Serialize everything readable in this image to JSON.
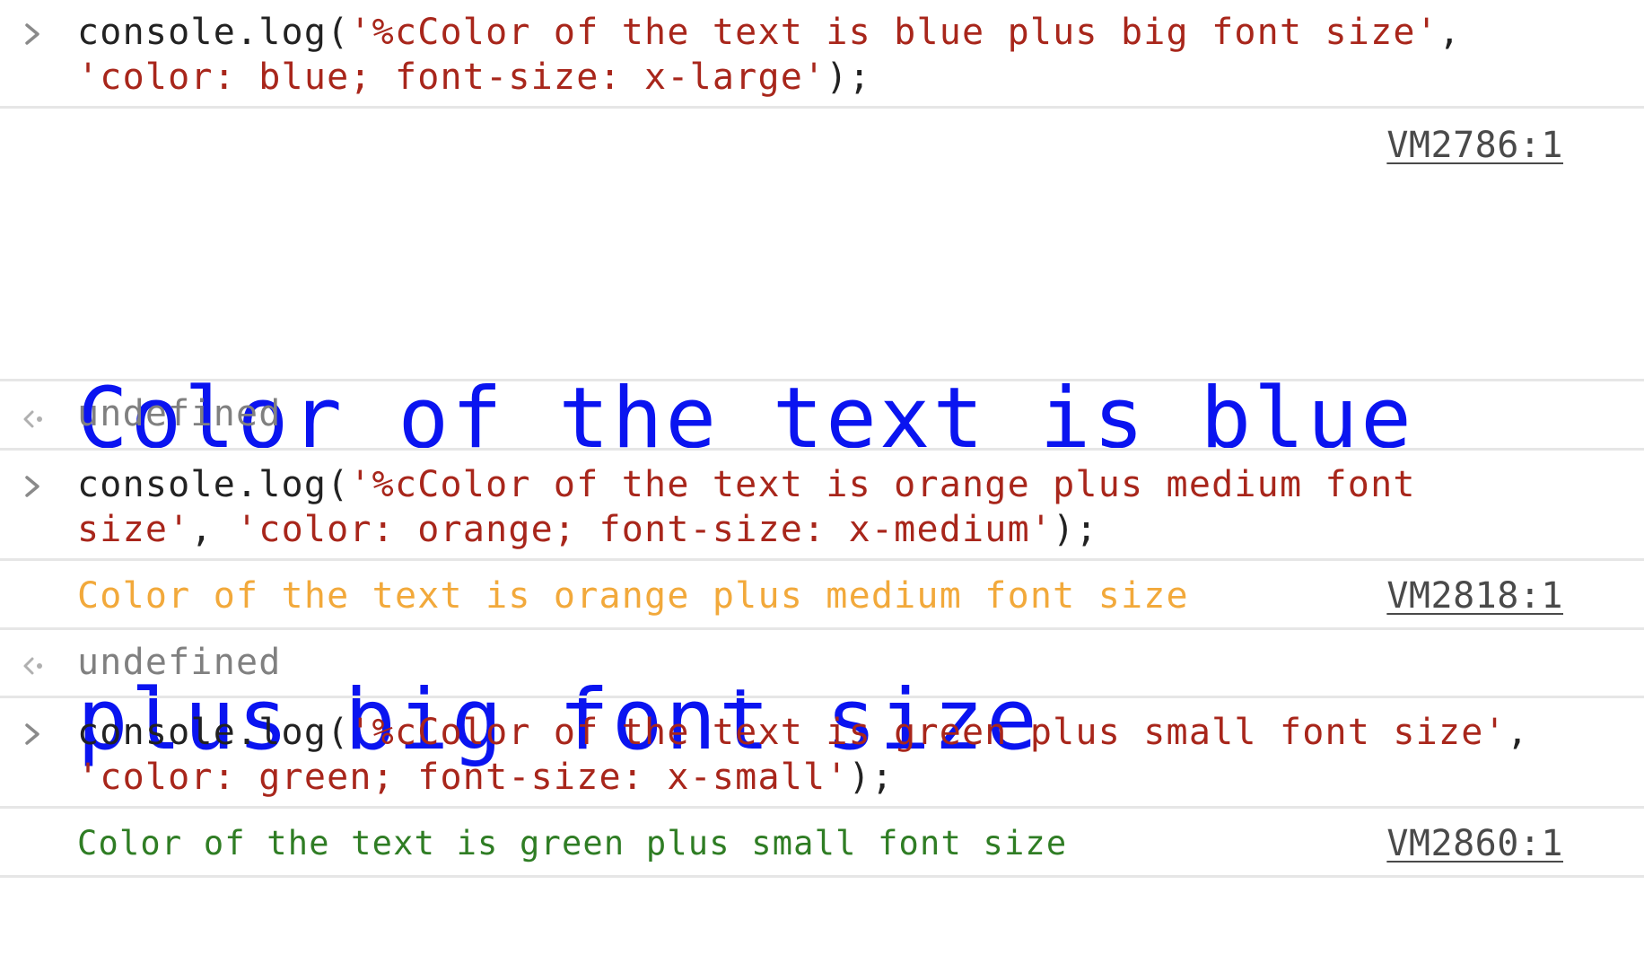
{
  "entries": [
    {
      "input": {
        "prefix": "console.log(",
        "string1": "'%cColor of the text is blue plus big font size'",
        "comma": ", ",
        "string2": "'color: blue; font-size: x-large'",
        "suffix": ");"
      },
      "output": {
        "line1": "Color of the text is blue",
        "line2": "plus big font size",
        "color": "#0a14f0",
        "source": "VM2786:1"
      },
      "result": "undefined"
    },
    {
      "input": {
        "prefix": "console.log(",
        "string1": "'%cColor of the text is orange plus medium font size'",
        "comma": ", ",
        "string2": "'color: orange; font-size: x-medium'",
        "suffix": ");"
      },
      "output": {
        "text": "Color of the text is orange plus medium font size",
        "color": "#f2a93b",
        "source": "VM2818:1"
      },
      "result": "undefined"
    },
    {
      "input": {
        "prefix": "console.log(",
        "string1": "'%cColor of the text is green plus small font size'",
        "comma": ", ",
        "string2": "'color: green; font-size: x-small'",
        "suffix": ");"
      },
      "output": {
        "text": "Color of the text is green plus small font size",
        "color": "#2f7d24",
        "source": "VM2860:1"
      }
    }
  ],
  "icons": {
    "prompt": "chevron-right-icon",
    "result": "result-arrow-icon"
  },
  "colors": {
    "code_text": "#222222",
    "string_literal": "#a8261b",
    "result_text": "#808080",
    "separator": "#e6e6e6"
  }
}
